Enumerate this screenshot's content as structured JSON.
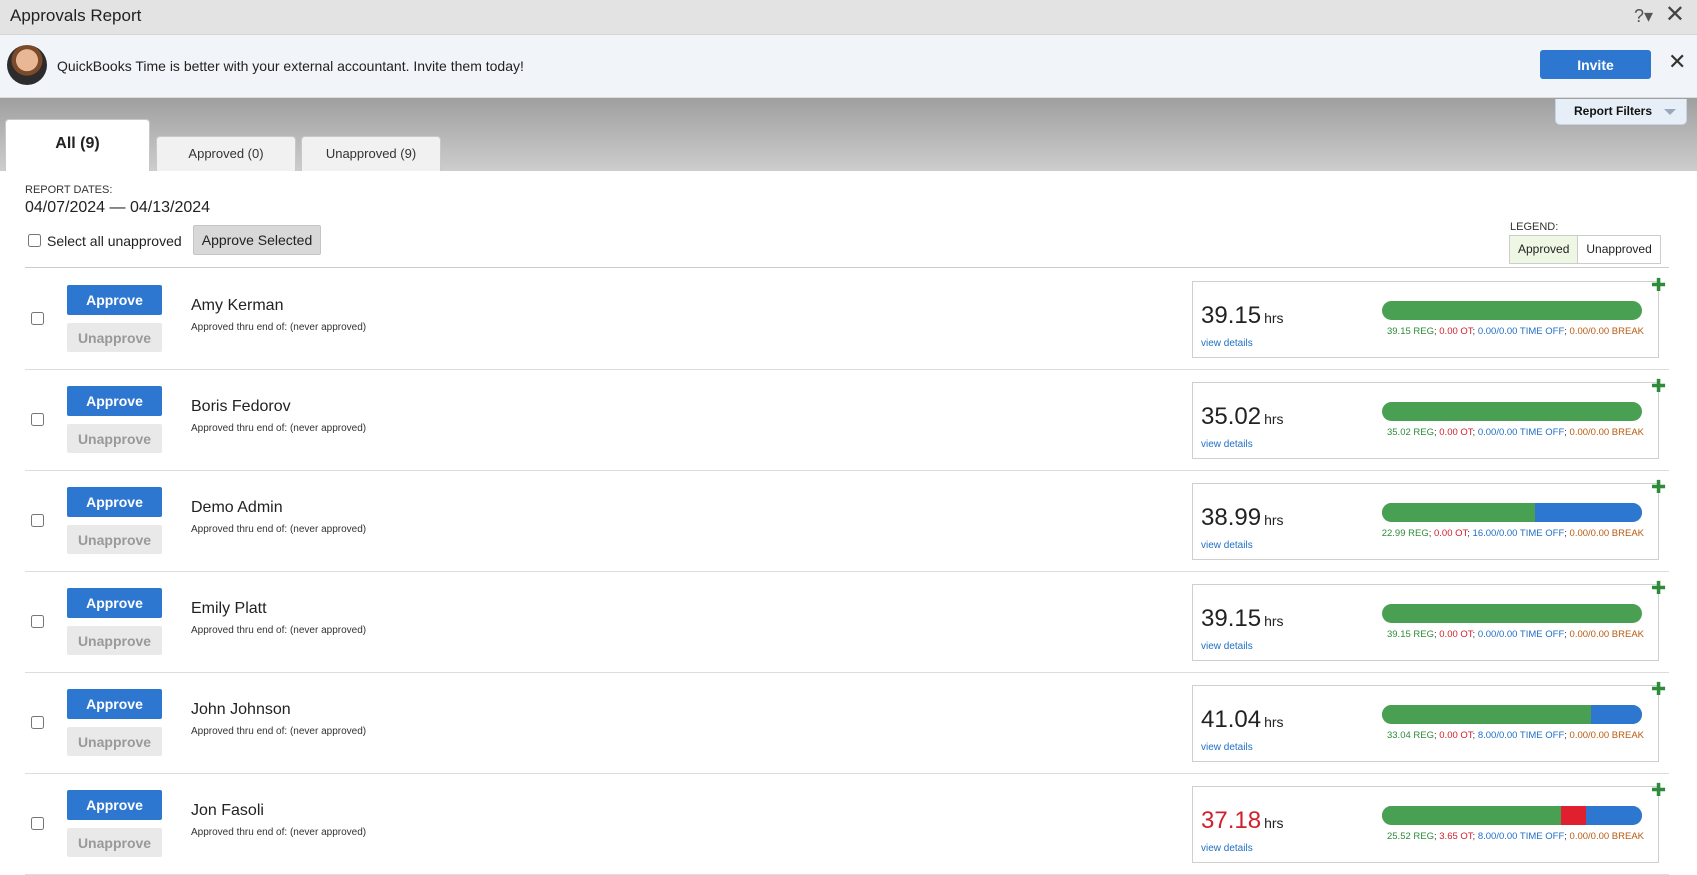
{
  "window": {
    "title": "Approvals Report",
    "help_glyph": "?▾",
    "close_glyph": "✕"
  },
  "banner": {
    "message": "QuickBooks Time is better with your external accountant. Invite them today!",
    "invite_label": "Invite",
    "close_glyph": "✕"
  },
  "tabs": [
    {
      "label": "All (9)"
    },
    {
      "label": "Approved (0)"
    },
    {
      "label": "Unapproved (9)"
    }
  ],
  "filters": {
    "label": "Report Filters"
  },
  "report": {
    "dates_label": "REPORT DATES:",
    "dates_value": "04/07/2024 — 04/13/2024",
    "select_all_label": "Select all unapproved",
    "approve_selected_label": "Approve Selected",
    "legend_label": "LEGEND:",
    "legend_approved": "Approved",
    "legend_unapproved": "Unapproved"
  },
  "labels": {
    "approve": "Approve",
    "unapprove": "Unapprove",
    "hrs_unit": "hrs",
    "view_details": "view details",
    "plus_glyph": "✚"
  },
  "colors": {
    "primary": "#2e77d0",
    "regular": "#4aa052",
    "overtime": "#e0202e",
    "time_off": "#2e77d0",
    "break": "#b85a10"
  },
  "employees": [
    {
      "name": "Amy Kerman",
      "thru": "Approved thru end of: (never approved)",
      "total": "39.15",
      "overtime_flag": false,
      "reg": "39.15 REG",
      "ot": "0.00 OT",
      "timeoff": "0.00/0.00 TIME OFF",
      "brk": "0.00/0.00 BREAK",
      "reg_value": 39.15,
      "ot_value": 0,
      "timeoff_value": 0
    },
    {
      "name": "Boris Fedorov",
      "thru": "Approved thru end of: (never approved)",
      "total": "35.02",
      "overtime_flag": false,
      "reg": "35.02 REG",
      "ot": "0.00 OT",
      "timeoff": "0.00/0.00 TIME OFF",
      "brk": "0.00/0.00 BREAK",
      "reg_value": 35.02,
      "ot_value": 0,
      "timeoff_value": 0
    },
    {
      "name": "Demo Admin",
      "thru": "Approved thru end of: (never approved)",
      "total": "38.99",
      "overtime_flag": false,
      "reg": "22.99 REG",
      "ot": "0.00 OT",
      "timeoff": "16.00/0.00 TIME OFF",
      "brk": "0.00/0.00 BREAK",
      "reg_value": 22.99,
      "ot_value": 0,
      "timeoff_value": 16.0
    },
    {
      "name": "Emily Platt",
      "thru": "Approved thru end of: (never approved)",
      "total": "39.15",
      "overtime_flag": false,
      "reg": "39.15 REG",
      "ot": "0.00 OT",
      "timeoff": "0.00/0.00 TIME OFF",
      "brk": "0.00/0.00 BREAK",
      "reg_value": 39.15,
      "ot_value": 0,
      "timeoff_value": 0
    },
    {
      "name": "John Johnson",
      "thru": "Approved thru end of: (never approved)",
      "total": "41.04",
      "overtime_flag": false,
      "reg": "33.04 REG",
      "ot": "0.00 OT",
      "timeoff": "8.00/0.00 TIME OFF",
      "brk": "0.00/0.00 BREAK",
      "reg_value": 33.04,
      "ot_value": 0,
      "timeoff_value": 8.0
    },
    {
      "name": "Jon Fasoli",
      "thru": "Approved thru end of: (never approved)",
      "total": "37.18",
      "overtime_flag": true,
      "reg": "25.52 REG",
      "ot": "3.65 OT",
      "timeoff": "8.00/0.00 TIME OFF",
      "brk": "0.00/0.00 BREAK",
      "reg_value": 25.52,
      "ot_value": 3.65,
      "timeoff_value": 8.0
    }
  ]
}
